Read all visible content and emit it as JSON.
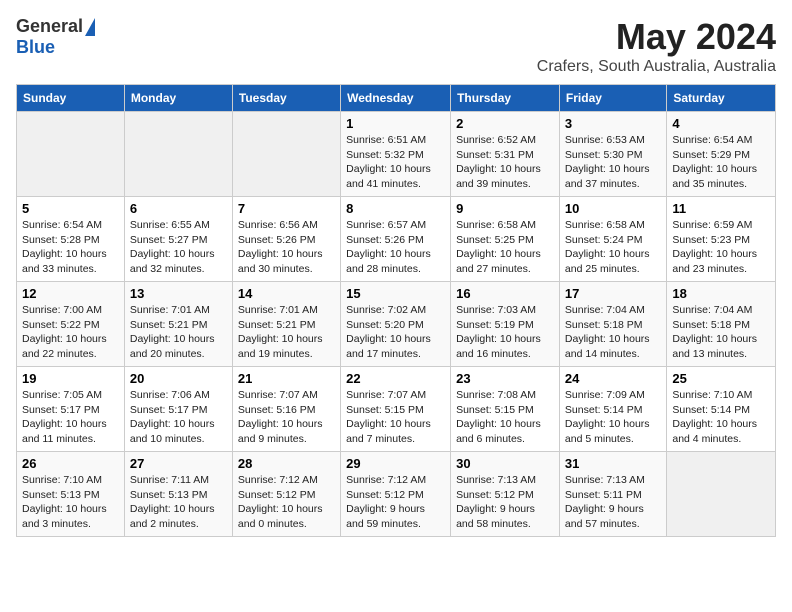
{
  "logo": {
    "general": "General",
    "blue": "Blue"
  },
  "title": {
    "month_year": "May 2024",
    "location": "Crafers, South Australia, Australia"
  },
  "days_of_week": [
    "Sunday",
    "Monday",
    "Tuesday",
    "Wednesday",
    "Thursday",
    "Friday",
    "Saturday"
  ],
  "weeks": [
    [
      {
        "day": "",
        "info": ""
      },
      {
        "day": "",
        "info": ""
      },
      {
        "day": "",
        "info": ""
      },
      {
        "day": "1",
        "info": "Sunrise: 6:51 AM\nSunset: 5:32 PM\nDaylight: 10 hours\nand 41 minutes."
      },
      {
        "day": "2",
        "info": "Sunrise: 6:52 AM\nSunset: 5:31 PM\nDaylight: 10 hours\nand 39 minutes."
      },
      {
        "day": "3",
        "info": "Sunrise: 6:53 AM\nSunset: 5:30 PM\nDaylight: 10 hours\nand 37 minutes."
      },
      {
        "day": "4",
        "info": "Sunrise: 6:54 AM\nSunset: 5:29 PM\nDaylight: 10 hours\nand 35 minutes."
      }
    ],
    [
      {
        "day": "5",
        "info": "Sunrise: 6:54 AM\nSunset: 5:28 PM\nDaylight: 10 hours\nand 33 minutes."
      },
      {
        "day": "6",
        "info": "Sunrise: 6:55 AM\nSunset: 5:27 PM\nDaylight: 10 hours\nand 32 minutes."
      },
      {
        "day": "7",
        "info": "Sunrise: 6:56 AM\nSunset: 5:26 PM\nDaylight: 10 hours\nand 30 minutes."
      },
      {
        "day": "8",
        "info": "Sunrise: 6:57 AM\nSunset: 5:26 PM\nDaylight: 10 hours\nand 28 minutes."
      },
      {
        "day": "9",
        "info": "Sunrise: 6:58 AM\nSunset: 5:25 PM\nDaylight: 10 hours\nand 27 minutes."
      },
      {
        "day": "10",
        "info": "Sunrise: 6:58 AM\nSunset: 5:24 PM\nDaylight: 10 hours\nand 25 minutes."
      },
      {
        "day": "11",
        "info": "Sunrise: 6:59 AM\nSunset: 5:23 PM\nDaylight: 10 hours\nand 23 minutes."
      }
    ],
    [
      {
        "day": "12",
        "info": "Sunrise: 7:00 AM\nSunset: 5:22 PM\nDaylight: 10 hours\nand 22 minutes."
      },
      {
        "day": "13",
        "info": "Sunrise: 7:01 AM\nSunset: 5:21 PM\nDaylight: 10 hours\nand 20 minutes."
      },
      {
        "day": "14",
        "info": "Sunrise: 7:01 AM\nSunset: 5:21 PM\nDaylight: 10 hours\nand 19 minutes."
      },
      {
        "day": "15",
        "info": "Sunrise: 7:02 AM\nSunset: 5:20 PM\nDaylight: 10 hours\nand 17 minutes."
      },
      {
        "day": "16",
        "info": "Sunrise: 7:03 AM\nSunset: 5:19 PM\nDaylight: 10 hours\nand 16 minutes."
      },
      {
        "day": "17",
        "info": "Sunrise: 7:04 AM\nSunset: 5:18 PM\nDaylight: 10 hours\nand 14 minutes."
      },
      {
        "day": "18",
        "info": "Sunrise: 7:04 AM\nSunset: 5:18 PM\nDaylight: 10 hours\nand 13 minutes."
      }
    ],
    [
      {
        "day": "19",
        "info": "Sunrise: 7:05 AM\nSunset: 5:17 PM\nDaylight: 10 hours\nand 11 minutes."
      },
      {
        "day": "20",
        "info": "Sunrise: 7:06 AM\nSunset: 5:17 PM\nDaylight: 10 hours\nand 10 minutes."
      },
      {
        "day": "21",
        "info": "Sunrise: 7:07 AM\nSunset: 5:16 PM\nDaylight: 10 hours\nand 9 minutes."
      },
      {
        "day": "22",
        "info": "Sunrise: 7:07 AM\nSunset: 5:15 PM\nDaylight: 10 hours\nand 7 minutes."
      },
      {
        "day": "23",
        "info": "Sunrise: 7:08 AM\nSunset: 5:15 PM\nDaylight: 10 hours\nand 6 minutes."
      },
      {
        "day": "24",
        "info": "Sunrise: 7:09 AM\nSunset: 5:14 PM\nDaylight: 10 hours\nand 5 minutes."
      },
      {
        "day": "25",
        "info": "Sunrise: 7:10 AM\nSunset: 5:14 PM\nDaylight: 10 hours\nand 4 minutes."
      }
    ],
    [
      {
        "day": "26",
        "info": "Sunrise: 7:10 AM\nSunset: 5:13 PM\nDaylight: 10 hours\nand 3 minutes."
      },
      {
        "day": "27",
        "info": "Sunrise: 7:11 AM\nSunset: 5:13 PM\nDaylight: 10 hours\nand 2 minutes."
      },
      {
        "day": "28",
        "info": "Sunrise: 7:12 AM\nSunset: 5:12 PM\nDaylight: 10 hours\nand 0 minutes."
      },
      {
        "day": "29",
        "info": "Sunrise: 7:12 AM\nSunset: 5:12 PM\nDaylight: 9 hours\nand 59 minutes."
      },
      {
        "day": "30",
        "info": "Sunrise: 7:13 AM\nSunset: 5:12 PM\nDaylight: 9 hours\nand 58 minutes."
      },
      {
        "day": "31",
        "info": "Sunrise: 7:13 AM\nSunset: 5:11 PM\nDaylight: 9 hours\nand 57 minutes."
      },
      {
        "day": "",
        "info": ""
      }
    ]
  ]
}
